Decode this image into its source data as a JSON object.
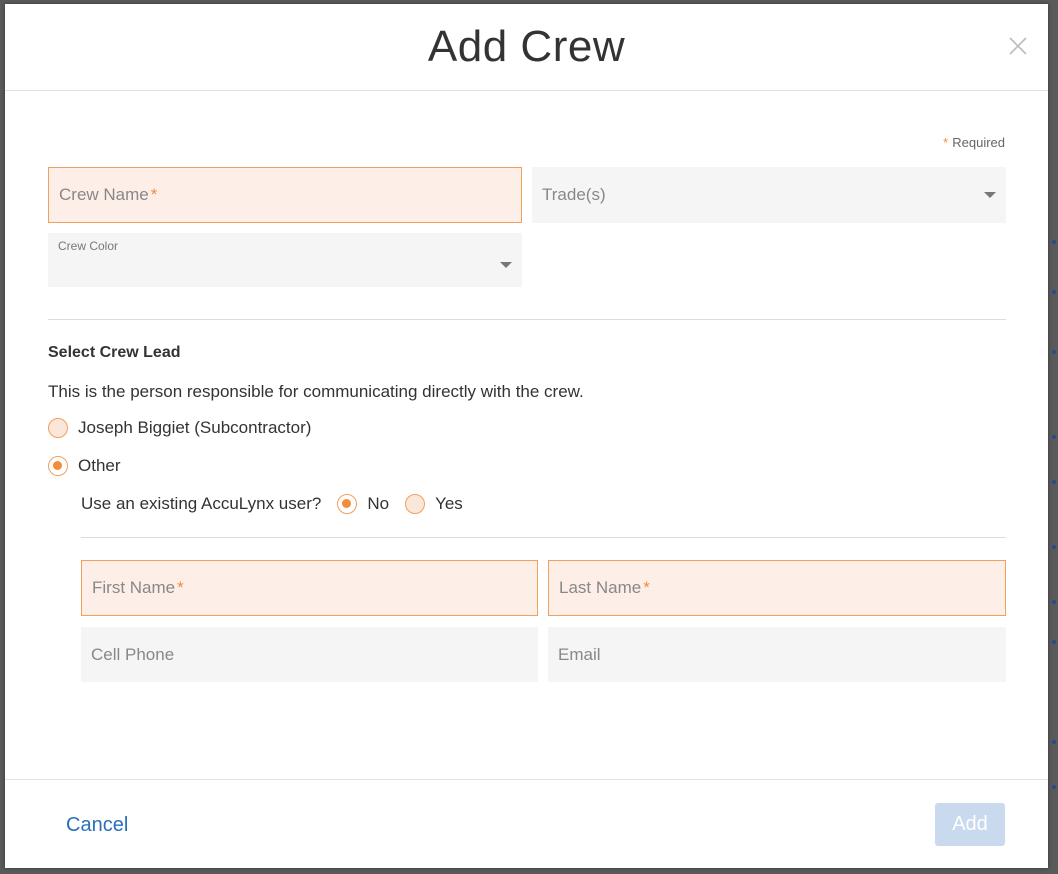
{
  "dialog": {
    "title": "Add Crew",
    "required_note": "Required",
    "required_star": "*"
  },
  "fields": {
    "crew_name": {
      "placeholder": "Crew Name",
      "required": true,
      "value": ""
    },
    "trades": {
      "placeholder": "Trade(s)",
      "value": ""
    },
    "crew_color": {
      "label": "Crew Color",
      "value": ""
    },
    "first_name": {
      "placeholder": "First Name",
      "required": true,
      "value": ""
    },
    "last_name": {
      "placeholder": "Last Name",
      "required": true,
      "value": ""
    },
    "cell_phone": {
      "placeholder": "Cell Phone",
      "value": ""
    },
    "email": {
      "placeholder": "Email",
      "value": ""
    }
  },
  "crew_lead": {
    "title": "Select Crew Lead",
    "description": "This is the person responsible for communicating directly with the crew.",
    "options": [
      {
        "label": "Joseph Biggiet (Subcontractor)",
        "checked": false
      },
      {
        "label": "Other",
        "checked": true
      }
    ],
    "existing_user_question": "Use an existing AccuLynx user?",
    "existing_user_options": [
      {
        "label": "No",
        "checked": true
      },
      {
        "label": "Yes",
        "checked": false
      }
    ]
  },
  "footer": {
    "cancel_label": "Cancel",
    "add_label": "Add"
  },
  "colors": {
    "accent": "#f28c38",
    "link": "#2a6fb8",
    "add_button_disabled": "#c9daee"
  }
}
